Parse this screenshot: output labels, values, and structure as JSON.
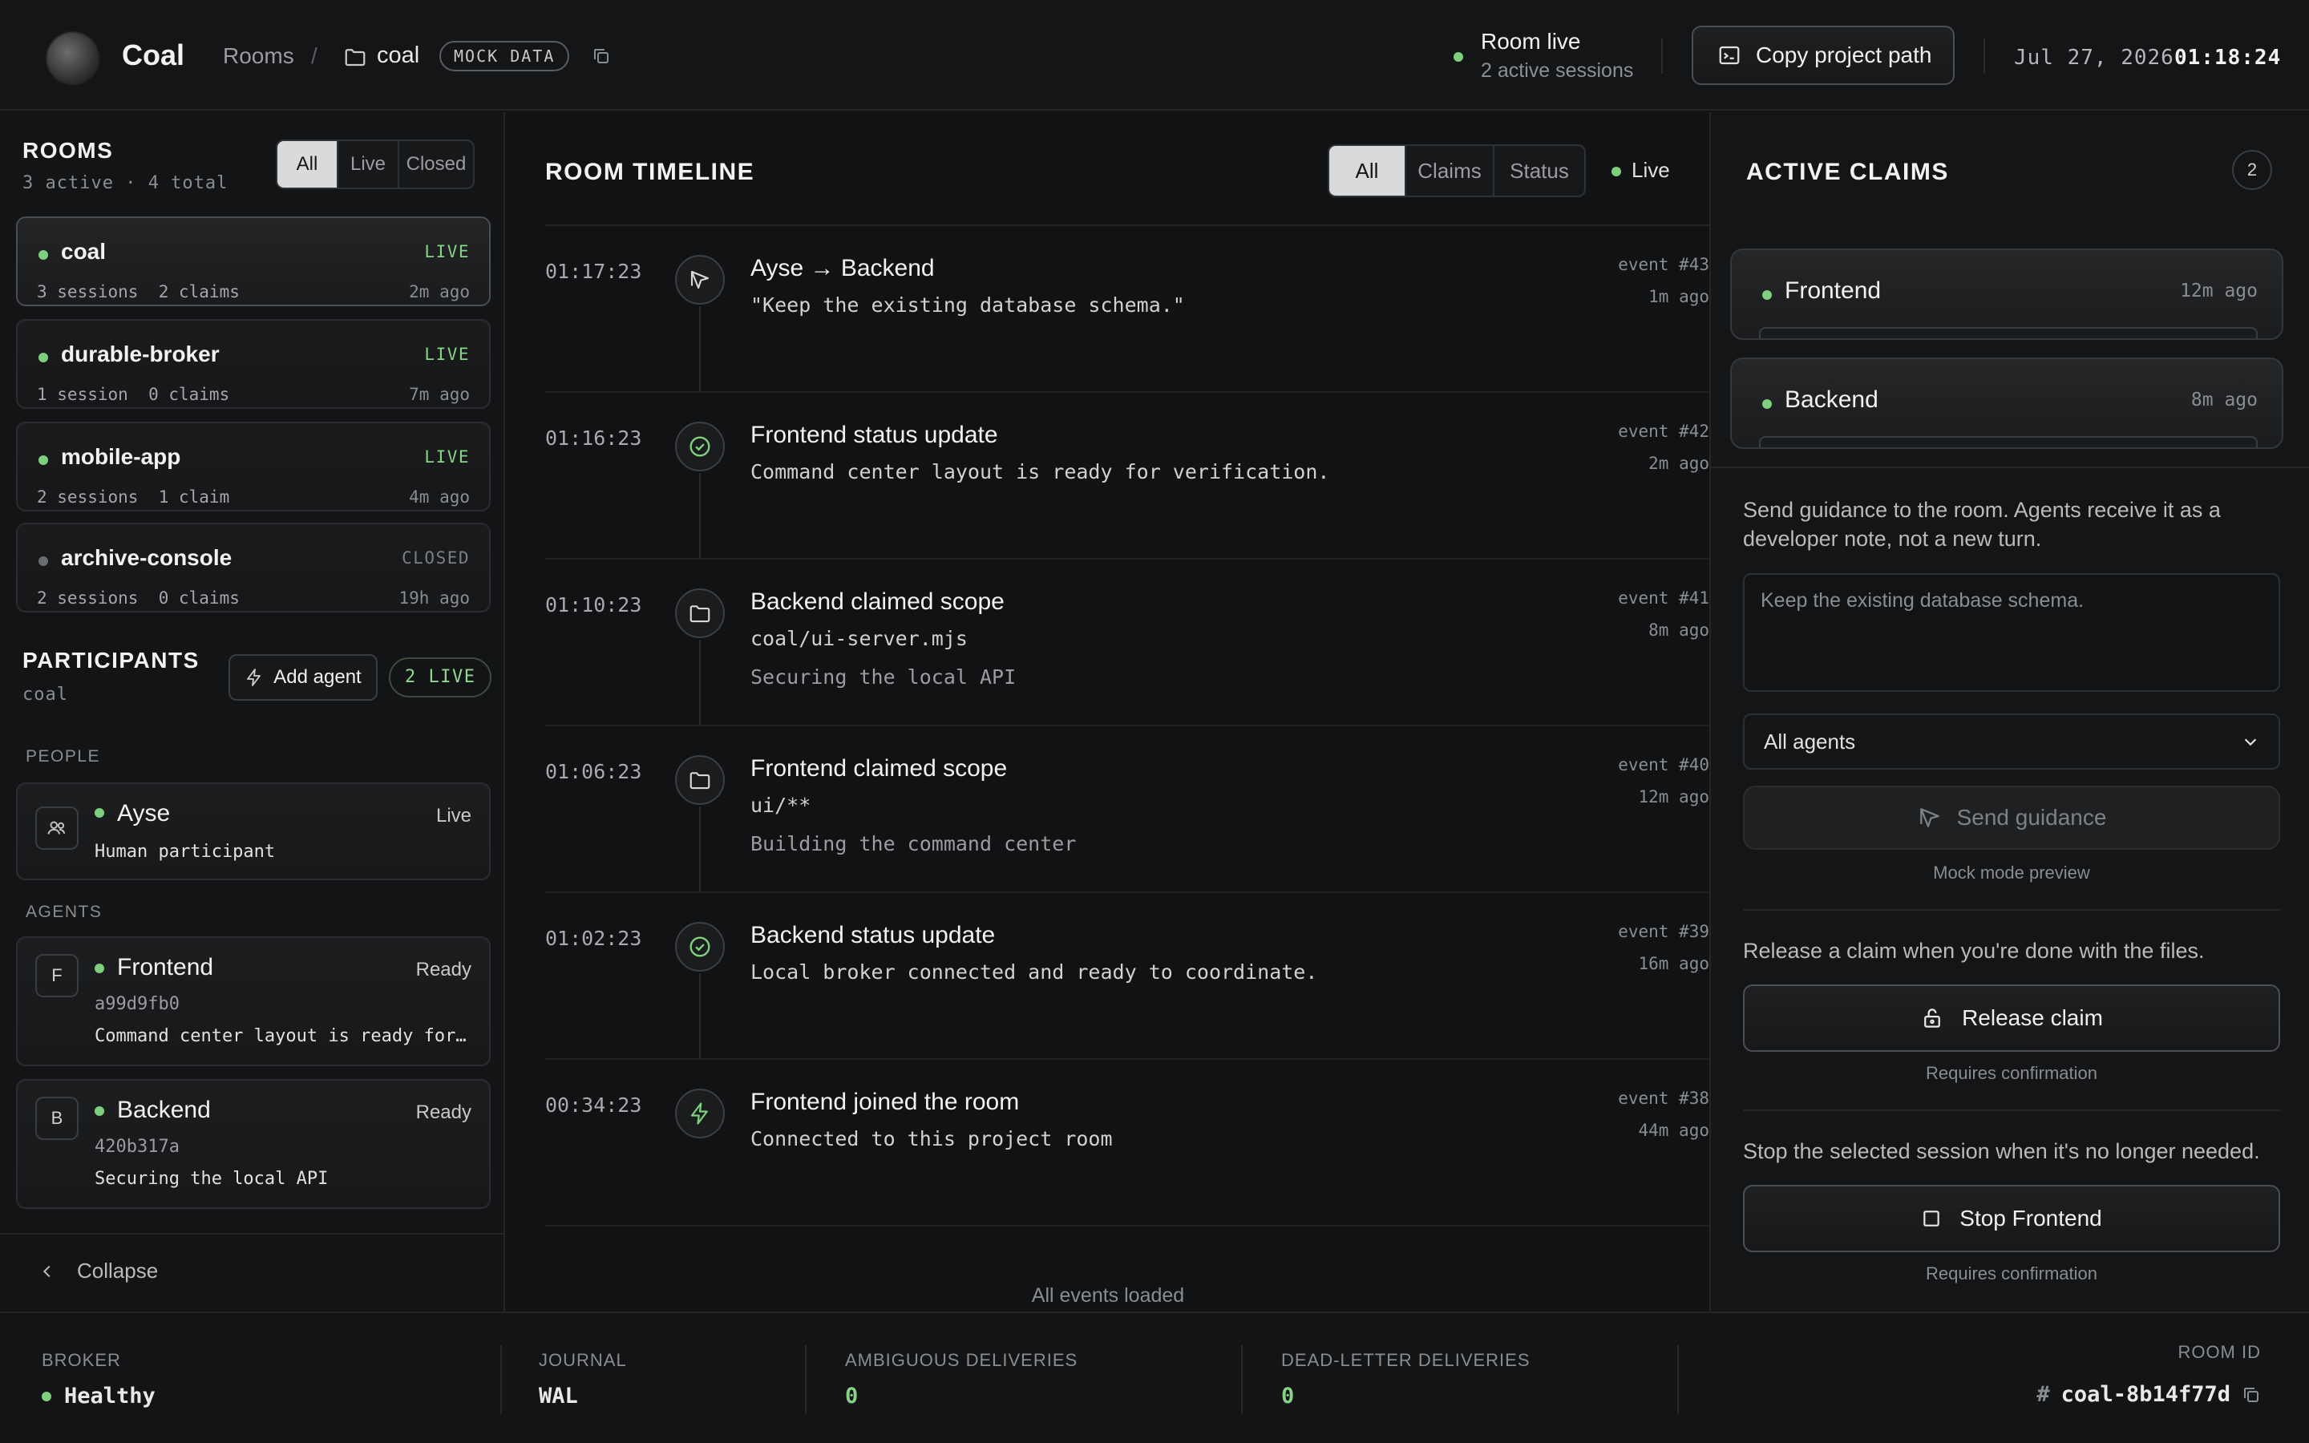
{
  "header": {
    "app_title": "Coal",
    "breadcrumb_rooms": "Rooms",
    "breadcrumb_sep": "/",
    "breadcrumb_project": "coal",
    "mock_badge": "MOCK DATA",
    "room_status_title": "Room live",
    "room_status_sub": "2 active sessions",
    "copy_path_label": "Copy project path",
    "date": "Jul 27, 2026",
    "time": "01:18:24"
  },
  "sidebar": {
    "rooms_title": "ROOMS",
    "rooms_sub": "3 active · 4 total",
    "room_filters": [
      "All",
      "Live",
      "Closed"
    ],
    "rooms": [
      {
        "name": "coal",
        "status": "LIVE",
        "meta": "3 sessions  2 claims",
        "ago": "2m ago"
      },
      {
        "name": "durable-broker",
        "status": "LIVE",
        "meta": "1 session  0 claims",
        "ago": "7m ago"
      },
      {
        "name": "mobile-app",
        "status": "LIVE",
        "meta": "2 sessions  1 claim",
        "ago": "4m ago"
      },
      {
        "name": "archive-console",
        "status": "CLOSED",
        "meta": "2 sessions  0 claims",
        "ago": "19h ago"
      }
    ],
    "participants_title": "PARTICIPANTS",
    "participants_sub": "coal",
    "add_agent_label": "Add agent",
    "live_count": "2 LIVE",
    "people_label": "PEOPLE",
    "agents_label": "AGENTS",
    "person": {
      "name": "Ayse",
      "state": "Live",
      "role": "Human participant"
    },
    "agents": [
      {
        "initial": "F",
        "name": "Frontend",
        "state": "Ready",
        "hash": "a99d9fb0",
        "note": "Command center layout is ready for…"
      },
      {
        "initial": "B",
        "name": "Backend",
        "state": "Ready",
        "hash": "420b317a",
        "note": "Securing the local API"
      }
    ],
    "collapse_label": "Collapse"
  },
  "timeline": {
    "title": "ROOM TIMELINE",
    "filters": [
      "All",
      "Claims",
      "Status"
    ],
    "live_label": "Live",
    "events": [
      {
        "time": "01:17:23",
        "icon": "send-icon",
        "title": "Ayse → Backend",
        "line1": "\"Keep the existing database schema.\"",
        "line2": "",
        "num": "event #43",
        "ago": "1m ago"
      },
      {
        "time": "01:16:23",
        "icon": "check-circle-icon",
        "title": "Frontend status update",
        "line1": "Command center layout is ready for verification.",
        "line2": "",
        "num": "event #42",
        "ago": "2m ago"
      },
      {
        "time": "01:10:23",
        "icon": "folder-icon",
        "title": "Backend claimed scope",
        "line1": "coal/ui-server.mjs",
        "line2": "Securing the local API",
        "num": "event #41",
        "ago": "8m ago"
      },
      {
        "time": "01:06:23",
        "icon": "folder-icon",
        "title": "Frontend claimed scope",
        "line1": "ui/**",
        "line2": "Building the command center",
        "num": "event #40",
        "ago": "12m ago"
      },
      {
        "time": "01:02:23",
        "icon": "check-circle-icon",
        "title": "Backend status update",
        "line1": "Local broker connected and ready to coordinate.",
        "line2": "",
        "num": "event #39",
        "ago": "16m ago"
      },
      {
        "time": "00:34:23",
        "icon": "bolt-icon",
        "title": "Frontend joined the room",
        "line1": "Connected to this project room",
        "line2": "",
        "num": "event #38",
        "ago": "44m ago"
      }
    ],
    "footer": "All events loaded"
  },
  "claims": {
    "title": "ACTIVE CLAIMS",
    "count": "2",
    "items": [
      {
        "name": "Frontend",
        "ago": "12m ago"
      },
      {
        "name": "Backend",
        "ago": "8m ago"
      }
    ],
    "guidance_help": "Send guidance to the room. Agents receive it as a developer note, not a new turn.",
    "guidance_placeholder": "Keep the existing database schema.",
    "target_select": "All agents",
    "send_label": "Send guidance",
    "send_note": "Mock mode preview",
    "release_help": "Release a claim when you're done with the files.",
    "release_label": "Release claim",
    "release_note": "Requires confirmation",
    "stop_help": "Stop the selected session when it's no longer needed.",
    "stop_label": "Stop Frontend",
    "stop_note": "Requires confirmation"
  },
  "footer": {
    "broker_label": "BROKER",
    "broker_value": "Healthy",
    "journal_label": "JOURNAL",
    "journal_value": "WAL",
    "ambiguous_label": "AMBIGUOUS DELIVERIES",
    "ambiguous_value": "0",
    "deadletter_label": "DEAD-LETTER DELIVERIES",
    "deadletter_value": "0",
    "room_id_label": "ROOM ID",
    "room_id_value": "coal-8b14f77d"
  },
  "colors": {
    "accent_live": "#7ed07e",
    "background": "#121314"
  }
}
